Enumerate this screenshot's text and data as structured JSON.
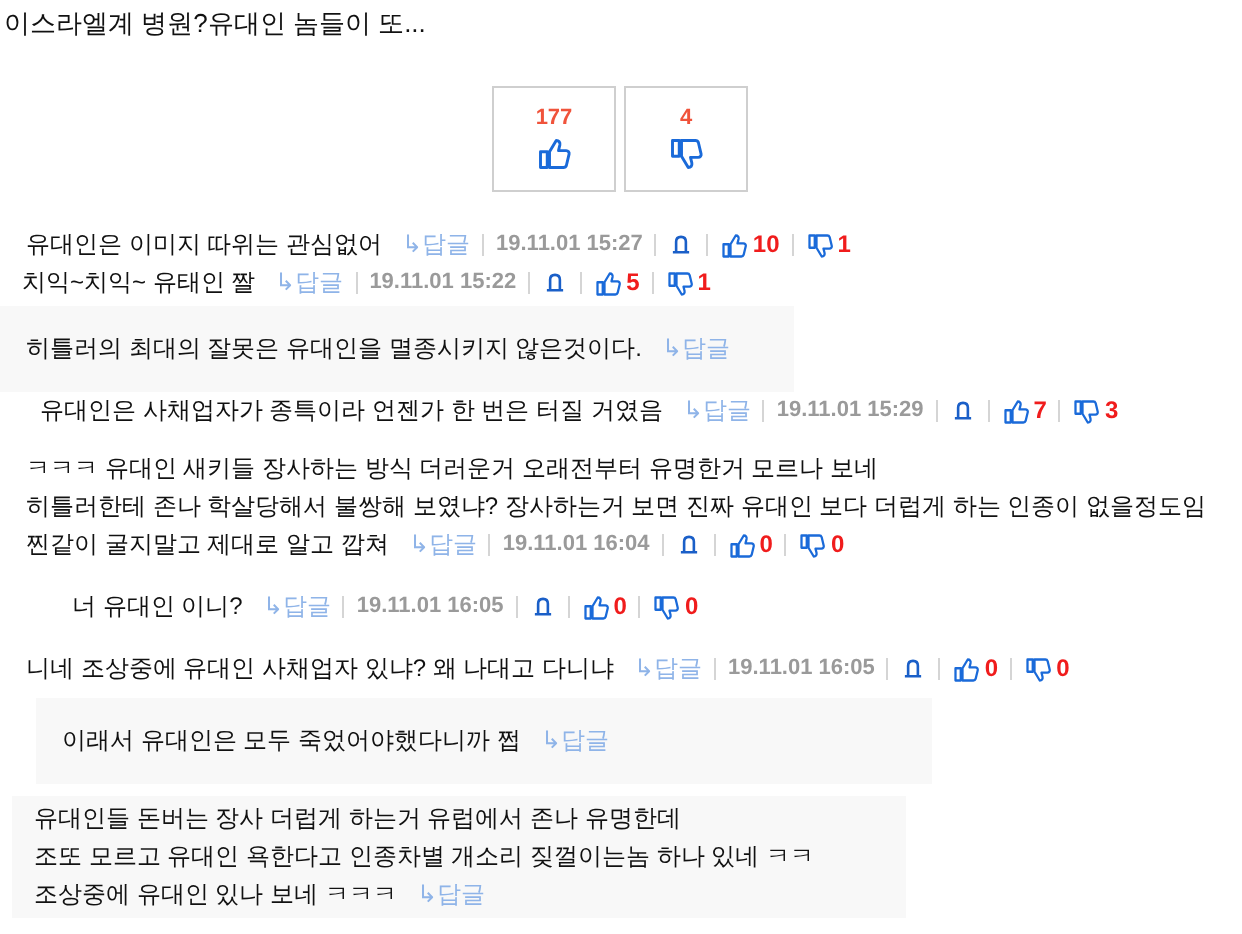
{
  "post": {
    "title": "이스라엘계 병원?유대인 놈들이 또..."
  },
  "votes": [
    {
      "kind": "up",
      "count": "177"
    },
    {
      "kind": "down",
      "count": "4"
    }
  ],
  "comments": [
    {
      "kind": "full",
      "lines": [
        "유대인은 이미지 따위는 관심없어"
      ],
      "reply": "↳답글",
      "date": "19.11.01 15:27",
      "up": "10",
      "down": "1"
    },
    {
      "kind": "full",
      "lines": [
        "치익~치익~ 유태인 짤"
      ],
      "reply": "↳답글",
      "date": "19.11.01 15:22",
      "up": "5",
      "down": "1"
    },
    {
      "kind": "boxed",
      "lines": [
        "히틀러의 최대의 잘못은 유대인을 멸종시키지 않은것이다."
      ],
      "reply": "↳답글"
    },
    {
      "kind": "full",
      "lines": [
        "유대인은 사채업자가 종특이라 언젠가 한 번은 터질 거였음"
      ],
      "reply": "↳답글",
      "date": "19.11.01 15:29",
      "up": "7",
      "down": "3"
    },
    {
      "kind": "full",
      "lines": [
        "ㅋㅋㅋ 유대인 새키들 장사하는 방식 더러운거 오래전부터 유명한거 모르나 보네",
        "히틀러한테 존나 학살당해서 불쌍해 보였냐? 장사하는거 보면 진짜 유대인 보다 더럽게 하는 인종이 없을정도임",
        "찐같이 굴지말고 제대로 알고 깝쳐"
      ],
      "reply": "↳답글",
      "date": "19.11.01 16:04",
      "up": "0",
      "down": "0"
    },
    {
      "kind": "full",
      "lines": [
        "너 유대인 이니?"
      ],
      "reply": "↳답글",
      "date": "19.11.01 16:05",
      "up": "0",
      "down": "0"
    },
    {
      "kind": "full",
      "lines": [
        "니네 조상중에 유대인 사채업자 있냐? 왜 나대고 다니냐"
      ],
      "reply": "↳답글",
      "date": "19.11.01 16:05",
      "up": "0",
      "down": "0"
    },
    {
      "kind": "boxed",
      "lines": [
        "이래서 유대인은 모두 죽었어야했다니까 쩝"
      ],
      "reply": "↳답글"
    },
    {
      "kind": "boxed",
      "lines": [
        "유대인들 돈버는 장사 더럽게 하는거 유럽에서 존나 유명한데",
        "조또 모르고 유대인 욕한다고 인종차별 개소리 짖껄이는놈 하나 있네 ㅋㅋ",
        "조상중에 유대인 있나 보네 ㅋㅋㅋ"
      ],
      "reply": "↳답글"
    }
  ]
}
